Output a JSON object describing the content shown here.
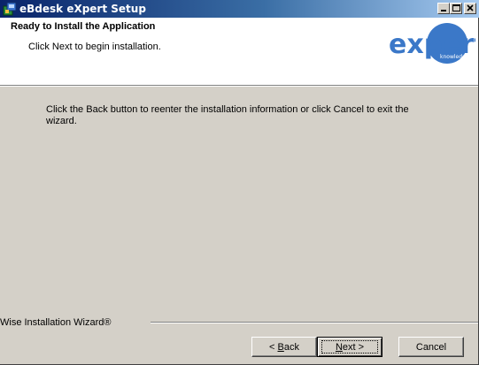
{
  "window": {
    "title": "eBdesk eXpert Setup"
  },
  "header": {
    "heading": "Ready to Install the Application",
    "subheading": "Click Next to begin installation.",
    "logo_text": "expert",
    "logo_tagline": "knowledge"
  },
  "body": {
    "instructions": "Click the Back button to reenter the installation information or click Cancel to exit the wizard."
  },
  "footer": {
    "brand": "Wise Installation Wizard®",
    "back": {
      "prefix": "< ",
      "mnemonic": "B",
      "rest": "ack"
    },
    "next": {
      "mnemonic": "N",
      "rest": "ext >"
    },
    "cancel": "Cancel"
  },
  "colors": {
    "title_start": "#0a246a",
    "title_end": "#a6caf0",
    "logo": "#3b78c8",
    "face": "#d4d0c8"
  }
}
